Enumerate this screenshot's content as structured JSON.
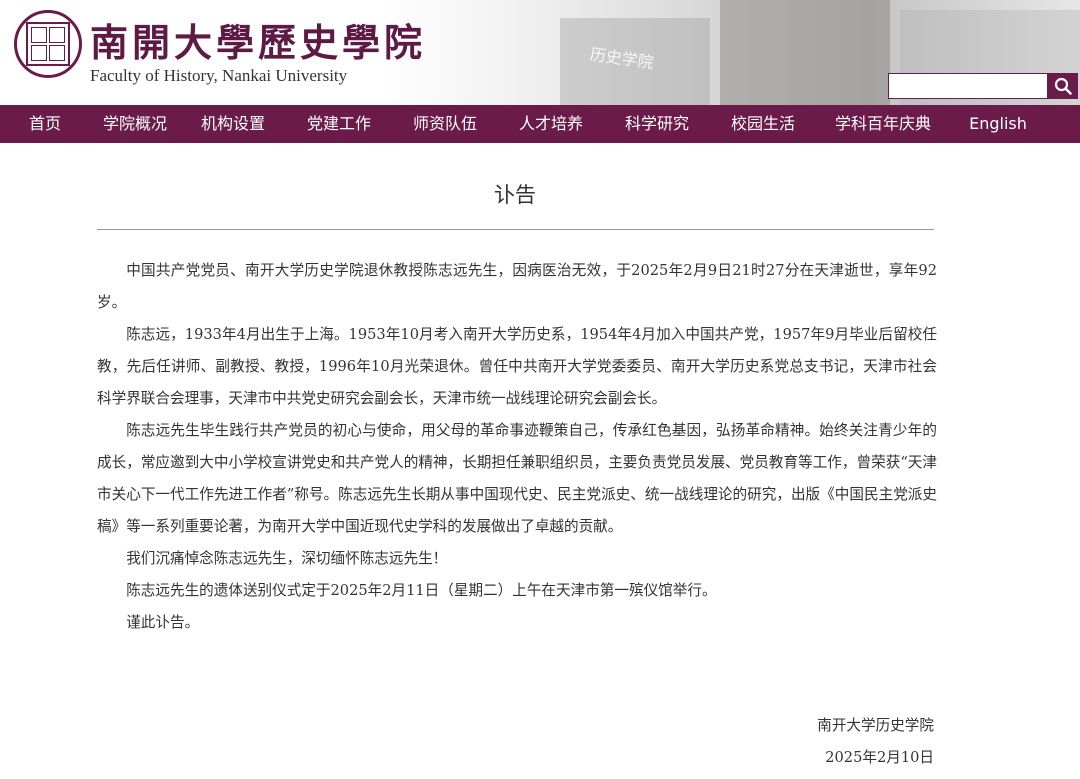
{
  "header": {
    "logo_cn": "南開大學歷史學院",
    "logo_en": "Faculty of History, Nankai University",
    "bg_sign": "历史学院",
    "search": {
      "value": "",
      "placeholder": ""
    }
  },
  "nav": {
    "items": [
      {
        "label": "首页"
      },
      {
        "label": "学院概况"
      },
      {
        "label": "机构设置"
      },
      {
        "label": "党建工作"
      },
      {
        "label": "师资队伍"
      },
      {
        "label": "人才培养"
      },
      {
        "label": "科学研究"
      },
      {
        "label": "校园生活"
      },
      {
        "label": "学科百年庆典"
      },
      {
        "label": "English"
      }
    ]
  },
  "article": {
    "title": "讣告",
    "paragraphs": [
      "中国共产党党员、南开大学历史学院退休教授陈志远先生，因病医治无效，于2025年2月9日21时27分在天津逝世，享年92岁。",
      "陈志远，1933年4月出生于上海。1953年10月考入南开大学历史系，1954年4月加入中国共产党，1957年9月毕业后留校任教，先后任讲师、副教授、教授，1996年10月光荣退休。曾任中共南开大学党委委员、南开大学历史系党总支书记，天津市社会科学界联合会理事，天津市中共党史研究会副会长，天津市统一战线理论研究会副会长。",
      "陈志远先生毕生践行共产党员的初心与使命，用父母的革命事迹鞭策自己，传承红色基因，弘扬革命精神。始终关注青少年的成长，常应邀到大中小学校宣讲党史和共产党人的精神，长期担任兼职组织员，主要负责党员发展、党员教育等工作，曾荣获“天津市关心下一代工作先进工作者”称号。陈志远先生长期从事中国现代史、民主党派史、统一战线理论的研究，出版《中国民主党派史稿》等一系列重要论著，为南开大学中国近现代史学科的发展做出了卓越的贡献。",
      "我们沉痛悼念陈志远先生，深切缅怀陈志远先生！",
      "陈志远先生的遗体送别仪式定于2025年2月11日（星期二）上午在天津市第一殡仪馆举行。",
      "谨此讣告。"
    ],
    "signature": "南开大学历史学院",
    "date": "2025年2月10日"
  },
  "colors": {
    "brand": "#6a1b4a",
    "nav_text": "#ffffff",
    "body_text": "#333333"
  },
  "icons": {
    "search": "search-icon",
    "logo": "university-seal-icon"
  }
}
